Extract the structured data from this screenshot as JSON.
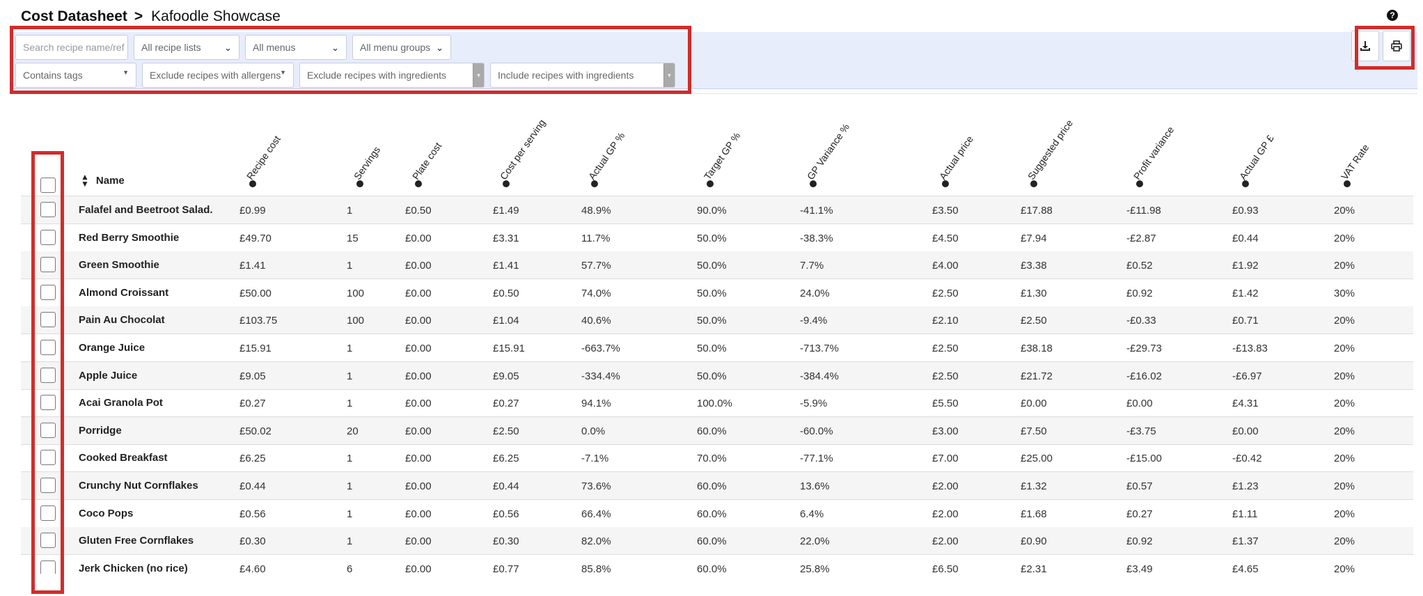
{
  "breadcrumb": {
    "root": "Cost Datasheet",
    "separator": ">",
    "current": "Kafoodle Showcase"
  },
  "help_icon": "question-circle-icon",
  "filters": {
    "search_placeholder": "Search recipe name/ref",
    "recipe_lists": "All recipe lists",
    "menus": "All menus",
    "menu_groups": "All menu groups",
    "contains_tags": "Contains tags",
    "exclude_allergens": "Exclude recipes with allergens",
    "exclude_ingredients": "Exclude recipes with ingredients",
    "include_ingredients": "Include recipes with ingredients"
  },
  "toolbar": {
    "download_icon": "download-icon",
    "print_icon": "print-icon"
  },
  "table": {
    "name_header": "Name",
    "columns": [
      "Recipe cost",
      "Servings",
      "Plate cost",
      "Cost per serving",
      "Actual GP %",
      "Target GP %",
      "GP Variance %",
      "Actual price",
      "Suggested price",
      "Profit variance",
      "Actual GP £",
      "VAT Rate"
    ],
    "rows": [
      {
        "name": "Falafel and Beetroot Salad.",
        "values": [
          "£0.99",
          "1",
          "£0.50",
          "£1.49",
          "48.9%",
          "90.0%",
          "-41.1%",
          "£3.50",
          "£17.88",
          "-£11.98",
          "£0.93",
          "20%"
        ]
      },
      {
        "name": "Red Berry Smoothie",
        "values": [
          "£49.70",
          "15",
          "£0.00",
          "£3.31",
          "11.7%",
          "50.0%",
          "-38.3%",
          "£4.50",
          "£7.94",
          "-£2.87",
          "£0.44",
          "20%"
        ]
      },
      {
        "name": "Green Smoothie",
        "values": [
          "£1.41",
          "1",
          "£0.00",
          "£1.41",
          "57.7%",
          "50.0%",
          "7.7%",
          "£4.00",
          "£3.38",
          "£0.52",
          "£1.92",
          "20%"
        ]
      },
      {
        "name": "Almond Croissant",
        "values": [
          "£50.00",
          "100",
          "£0.00",
          "£0.50",
          "74.0%",
          "50.0%",
          "24.0%",
          "£2.50",
          "£1.30",
          "£0.92",
          "£1.42",
          "30%"
        ]
      },
      {
        "name": "Pain Au Chocolat",
        "values": [
          "£103.75",
          "100",
          "£0.00",
          "£1.04",
          "40.6%",
          "50.0%",
          "-9.4%",
          "£2.10",
          "£2.50",
          "-£0.33",
          "£0.71",
          "20%"
        ]
      },
      {
        "name": "Orange Juice",
        "values": [
          "£15.91",
          "1",
          "£0.00",
          "£15.91",
          "-663.7%",
          "50.0%",
          "-713.7%",
          "£2.50",
          "£38.18",
          "-£29.73",
          "-£13.83",
          "20%"
        ]
      },
      {
        "name": "Apple Juice",
        "values": [
          "£9.05",
          "1",
          "£0.00",
          "£9.05",
          "-334.4%",
          "50.0%",
          "-384.4%",
          "£2.50",
          "£21.72",
          "-£16.02",
          "-£6.97",
          "20%"
        ]
      },
      {
        "name": "Acai Granola Pot",
        "values": [
          "£0.27",
          "1",
          "£0.00",
          "£0.27",
          "94.1%",
          "100.0%",
          "-5.9%",
          "£5.50",
          "£0.00",
          "£0.00",
          "£4.31",
          "20%"
        ]
      },
      {
        "name": "Porridge",
        "values": [
          "£50.02",
          "20",
          "£0.00",
          "£2.50",
          "0.0%",
          "60.0%",
          "-60.0%",
          "£3.00",
          "£7.50",
          "-£3.75",
          "£0.00",
          "20%"
        ]
      },
      {
        "name": "Cooked Breakfast",
        "values": [
          "£6.25",
          "1",
          "£0.00",
          "£6.25",
          "-7.1%",
          "70.0%",
          "-77.1%",
          "£7.00",
          "£25.00",
          "-£15.00",
          "-£0.42",
          "20%"
        ]
      },
      {
        "name": "Crunchy Nut Cornflakes",
        "values": [
          "£0.44",
          "1",
          "£0.00",
          "£0.44",
          "73.6%",
          "60.0%",
          "13.6%",
          "£2.00",
          "£1.32",
          "£0.57",
          "£1.23",
          "20%"
        ]
      },
      {
        "name": "Coco Pops",
        "values": [
          "£0.56",
          "1",
          "£0.00",
          "£0.56",
          "66.4%",
          "60.0%",
          "6.4%",
          "£2.00",
          "£1.68",
          "£0.27",
          "£1.11",
          "20%"
        ]
      },
      {
        "name": "Gluten Free Cornflakes",
        "values": [
          "£0.30",
          "1",
          "£0.00",
          "£0.30",
          "82.0%",
          "60.0%",
          "22.0%",
          "£2.00",
          "£0.90",
          "£0.92",
          "£1.37",
          "20%"
        ]
      },
      {
        "name": "Jerk Chicken (no rice)",
        "values": [
          "£4.60",
          "6",
          "£0.00",
          "£0.77",
          "85.8%",
          "60.0%",
          "25.8%",
          "£6.50",
          "£2.31",
          "£3.49",
          "£4.65",
          "20%"
        ]
      }
    ]
  },
  "colors": {
    "filter_bg": "#e8edfc",
    "highlight": "#d12c2c",
    "row_stripe": "#f5f5f5"
  }
}
